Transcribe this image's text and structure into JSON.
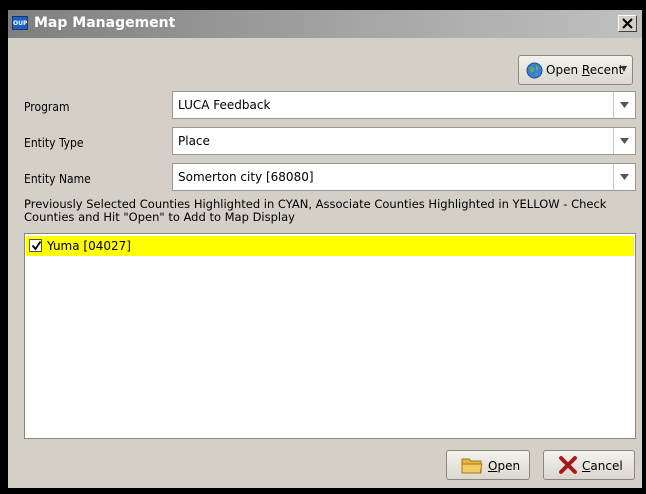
{
  "window": {
    "title": "Map Management",
    "app_icon_text": "OUPS"
  },
  "toolbar": {
    "open_recent_label": "Open Recent",
    "open_recent_mnemonic": "R",
    "open_recent_pre": "Open ",
    "open_recent_post": "ecent"
  },
  "form": {
    "program_label": "Program",
    "program_value": "LUCA Feedback",
    "entity_type_label": "Entity Type",
    "entity_type_value": "Place",
    "entity_name_label": "Entity Name",
    "entity_name_value": "Somerton city [68080]"
  },
  "instructions": "Previously Selected Counties Highlighted in CYAN, Associate Counties Highlighted in YELLOW - Check Counties and Hit \"Open\" to Add to Map Display",
  "counties": [
    {
      "label": "Yuma [04027]",
      "checked": true,
      "highlight": "#ffff00"
    }
  ],
  "buttons": {
    "open_label": "Open",
    "open_mnemonic": "O",
    "open_rest": "pen",
    "cancel_label": "Cancel",
    "cancel_mnemonic": "C",
    "cancel_rest": "ancel"
  },
  "colors": {
    "titlebar_start": "#7f7f7f",
    "dialog_bg": "#d4d0c8",
    "associate_highlight": "#ffff00"
  },
  "icons": [
    "app-icon",
    "close-icon",
    "globe-icon",
    "chevron-down-icon",
    "checkbox-icon",
    "folder-icon",
    "cancel-x-icon"
  ]
}
